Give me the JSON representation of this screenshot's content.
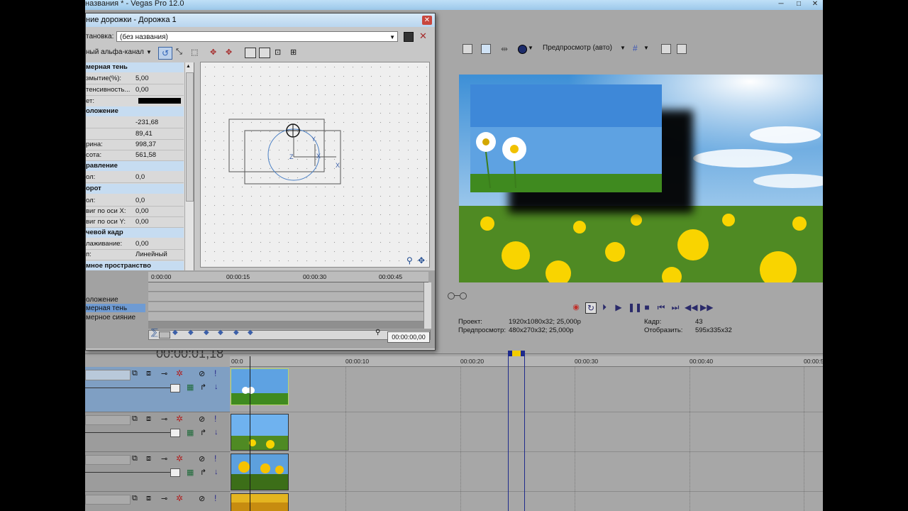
{
  "window": {
    "title": "названия * - Vegas Pro 12.0",
    "min": "─",
    "max": "□",
    "close": "✕"
  },
  "dialog": {
    "title": "ние дорожки - Дорожка 1",
    "close": "✕",
    "preset_label": "тановка:",
    "preset_value": "(без названия)",
    "channel_label": "ный альфа-канал",
    "sections": [
      {
        "title": "мерная тень",
        "rows": [
          {
            "k": "змытие(%):",
            "v": "5,00"
          },
          {
            "k": "тенсивность...",
            "v": "0,00"
          },
          {
            "k": "ет:",
            "v": ""
          }
        ]
      },
      {
        "title": "оложение",
        "rows": [
          {
            "k": "",
            "v": "-231,68"
          },
          {
            "k": "",
            "v": "89,41"
          },
          {
            "k": "рина:",
            "v": "998,37"
          },
          {
            "k": "сота:",
            "v": "561,58"
          }
        ]
      },
      {
        "title": "равление",
        "rows": [
          {
            "k": "ол:",
            "v": "0,0"
          }
        ]
      },
      {
        "title": "орот",
        "rows": [
          {
            "k": "ол:",
            "v": "0,0"
          },
          {
            "k": "виг по оси X:",
            "v": "0,00"
          },
          {
            "k": "виг по оси Y:",
            "v": "0,00"
          }
        ]
      },
      {
        "title": "чевой кадр",
        "rows": [
          {
            "k": "лаживание:",
            "v": "0,00"
          },
          {
            "k": "п:",
            "v": "Линейный"
          }
        ]
      },
      {
        "title": "мное пространство",
        "rows": []
      }
    ],
    "canvas_labels": {
      "x1": "X",
      "x2": "X",
      "y": "Y",
      "z": "Z"
    },
    "kf_ticks": [
      "0:00:00",
      "00:00:15",
      "00:00:30",
      "00:00:45"
    ],
    "kf_tracks": [
      "оложение",
      "мерная тень",
      "мерное сияние"
    ],
    "time": "00:00:00,00"
  },
  "preview": {
    "mode": "Предпросмотр (авто)",
    "project_label": "Проект:",
    "project_value": "1920x1080x32; 25,000p",
    "preview_label": "Предпросмотр:",
    "preview_value": "480x270x32; 25,000p",
    "frame_label": "Кадр:",
    "frame_value": "43",
    "display_label": "Отобразить:",
    "display_value": "595x335x32"
  },
  "timeline": {
    "cursor_time": "00:00:01,18",
    "ticks": [
      "00:0",
      "00:00:10",
      "00:00:20",
      "00:00:30",
      "00:00:40",
      "00:00:5"
    ]
  },
  "colors": {
    "accent_blue": "#2f62b6",
    "record_red": "#c0302a",
    "selected_track": "#7f9fc3"
  },
  "icons": [
    "save-icon",
    "delete-icon",
    "record-icon",
    "loop-icon",
    "play-icon",
    "pause-icon",
    "stop-icon",
    "zoom-icon",
    "move-icon"
  ]
}
